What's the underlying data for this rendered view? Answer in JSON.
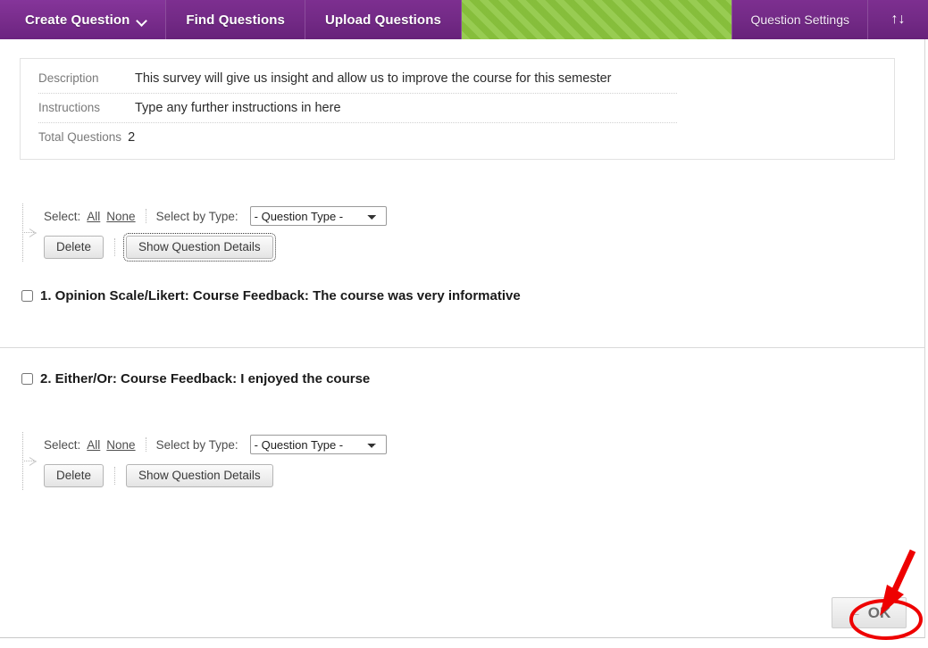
{
  "action_bar": {
    "tabs": [
      {
        "label": "Create Question",
        "has_chevron": true
      },
      {
        "label": "Find Questions",
        "has_chevron": false
      },
      {
        "label": "Upload Questions",
        "has_chevron": false
      }
    ],
    "spacer_color": "#8cc63e",
    "bar_color": "#73298a",
    "question_settings_label": "Question Settings",
    "sort_icon": "↑↓",
    "sort_icon_name": "sort-ascending-descending-icon"
  },
  "details": {
    "rows": [
      {
        "label": "Description",
        "value": "This survey will give us insight and allow us to improve the course for this semester"
      },
      {
        "label": "Instructions",
        "value": "Type any further instructions in here"
      },
      {
        "label": "Total Questions",
        "value": "2"
      }
    ]
  },
  "toolbar_top": {
    "select_label": "Select:",
    "select_all": "All",
    "select_none": "None",
    "select_by_type_label": "Select by Type:",
    "question_type_value": "- Question Type -",
    "question_type_options": [
      "- Question Type -"
    ],
    "delete_label": "Delete",
    "show_details_label": "Show Question Details",
    "show_details_focused": true
  },
  "toolbar_bottom": {
    "select_label": "Select:",
    "select_all": "All",
    "select_none": "None",
    "select_by_type_label": "Select by Type:",
    "question_type_value": "- Question Type -",
    "question_type_options": [
      "- Question Type -"
    ],
    "delete_label": "Delete",
    "show_details_label": "Show Question Details",
    "show_details_focused": false
  },
  "questions": [
    {
      "text": "1. Opinion Scale/Likert: Course Feedback: The course was very informative",
      "checked": false
    },
    {
      "text": "2. Either/Or: Course Feedback: I enjoyed the course",
      "checked": false
    }
  ],
  "footer": {
    "ok_label": "OK",
    "ok_arrow": "←"
  },
  "annotations": {
    "color": "#ee0000",
    "ellipse_target": "ok-button",
    "arrow_points_to": "ok-button"
  }
}
